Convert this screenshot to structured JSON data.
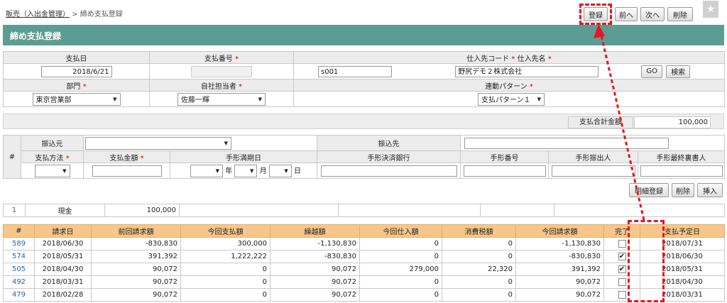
{
  "breadcrumb": {
    "parent": "販売（入出金管理）",
    "sep": " > ",
    "current": "締め支払登録"
  },
  "toolbar": {
    "register": "登録",
    "prev": "前へ",
    "next": "次へ",
    "delete": "削除"
  },
  "page_title": "締め支払登録",
  "header": {
    "payment_date_label": "支払日",
    "payment_no_label": "支払番号",
    "supplier_label": "仕入先コード",
    "supplier_name_label": "仕入先名",
    "required_mark": "*",
    "payment_date": "2018/6/21",
    "supplier_code": "s001",
    "supplier_name": "野尻デモ２株式会社",
    "go_btn": "GO",
    "search_btn": "検索",
    "dept_label": "部門",
    "staff_label": "自社担当者",
    "pattern_label": "連動パターン",
    "dept_value": "東京営業部",
    "staff_value": "佐藤一輝",
    "pattern_value": "支払パターン１"
  },
  "total": {
    "label": "支払合計金額",
    "value": "100,000"
  },
  "detail": {
    "hash": "#",
    "from_label": "振込元",
    "to_label": "振込先",
    "method_label": "支払方法",
    "amount_label": "支払金額",
    "due_label": "手形満期日",
    "bank_label": "手形決済銀行",
    "bill_no_label": "手形番号",
    "drawer_label": "手形振出人",
    "endorser_label": "手形最終裏書人",
    "year": "年",
    "month": "月",
    "day": "日"
  },
  "detail_buttons": {
    "register": "明細登録",
    "delete": "削除",
    "insert": "挿入"
  },
  "summary_row": {
    "no": "1",
    "method": "現金",
    "amount": "100,000"
  },
  "invoice_table": {
    "headers": [
      "#",
      "請求日",
      "前回請求額",
      "今回支払額",
      "繰越額",
      "今回仕入額",
      "消費税額",
      "今回請求額",
      "完了",
      "支払予定日"
    ],
    "rows": [
      {
        "id": "589",
        "date": "2018/06/30",
        "prev": "-830,830",
        "paid": "300,000",
        "carry": "-1,130,830",
        "purchase": "0",
        "tax": "0",
        "bill": "-1,130,830",
        "done": false,
        "due": "2018/07/31"
      },
      {
        "id": "574",
        "date": "2018/05/31",
        "prev": "391,392",
        "paid": "1,222,222",
        "carry": "-830,830",
        "purchase": "0",
        "tax": "0",
        "bill": "-830,830",
        "done": true,
        "due": "2018/06/30"
      },
      {
        "id": "505",
        "date": "2018/04/30",
        "prev": "90,072",
        "paid": "0",
        "carry": "90,072",
        "purchase": "279,000",
        "tax": "22,320",
        "bill": "391,392",
        "done": true,
        "due": "2018/05/31"
      },
      {
        "id": "492",
        "date": "2018/03/31",
        "prev": "90,072",
        "paid": "0",
        "carry": "90,072",
        "purchase": "0",
        "tax": "0",
        "bill": "90,072",
        "done": false,
        "due": "2018/04/30"
      },
      {
        "id": "479",
        "date": "2018/02/28",
        "prev": "90,072",
        "paid": "0",
        "carry": "90,072",
        "purchase": "0",
        "tax": "0",
        "bill": "90,072",
        "done": false,
        "due": "2018/03/31"
      }
    ]
  },
  "colors": {
    "title_bar": "#5d9c93",
    "table_header": "#f6c68a",
    "annotation": "#e8141e",
    "link": "#2566b0"
  }
}
